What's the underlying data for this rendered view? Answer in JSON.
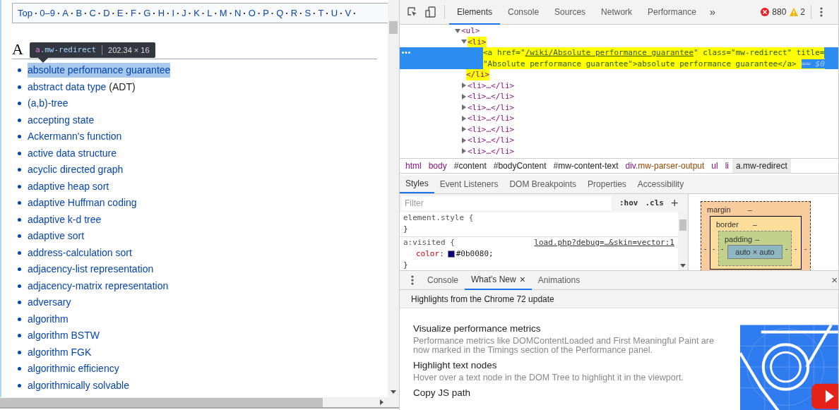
{
  "page": {
    "index_nav": [
      {
        "label": "Top",
        "separator": "·"
      },
      {
        "label": "0–9",
        "separator": "·"
      },
      {
        "label": "A",
        "separator": "·"
      },
      {
        "label": "B",
        "separator": "·"
      },
      {
        "label": "C",
        "separator": "·"
      },
      {
        "label": "D",
        "separator": "·"
      },
      {
        "label": "E",
        "separator": "·"
      },
      {
        "label": "F",
        "separator": "·"
      },
      {
        "label": "G",
        "separator": "·"
      },
      {
        "label": "H",
        "separator": "·"
      },
      {
        "label": "I",
        "separator": "·"
      },
      {
        "label": "J",
        "separator": "·"
      },
      {
        "label": "K",
        "separator": "·"
      },
      {
        "label": "L",
        "separator": "·"
      },
      {
        "label": "M",
        "separator": "·"
      },
      {
        "label": "N",
        "separator": "·"
      },
      {
        "label": "O",
        "separator": "·"
      },
      {
        "label": "P",
        "separator": "·"
      },
      {
        "label": "Q",
        "separator": "·"
      },
      {
        "label": "R",
        "separator": "·"
      },
      {
        "label": "S",
        "separator": "·"
      },
      {
        "label": "T",
        "separator": "·"
      },
      {
        "label": "U",
        "separator": "·"
      },
      {
        "label": "V",
        "separator": "·"
      }
    ],
    "heading": "A",
    "tooltip": {
      "tag": "a",
      "class_name": ".mw-redirect",
      "size": "202.34 × 16"
    },
    "entries": [
      {
        "label": "absolute performance guarantee",
        "selected": true
      },
      {
        "label": "abstract data type",
        "note": "(ADT)",
        "selected": false
      },
      {
        "label": "(a,b)-tree",
        "selected": false
      },
      {
        "label": "accepting state",
        "selected": false
      },
      {
        "label": "Ackermann's function",
        "selected": false
      },
      {
        "label": "active data structure",
        "selected": false
      },
      {
        "label": "acyclic directed graph",
        "selected": false
      },
      {
        "label": "adaptive heap sort",
        "selected": false
      },
      {
        "label": "adaptive Huffman coding",
        "selected": false
      },
      {
        "label": "adaptive k-d tree",
        "selected": false
      },
      {
        "label": "adaptive sort",
        "selected": false
      },
      {
        "label": "address-calculation sort",
        "selected": false
      },
      {
        "label": "adjacency-list representation",
        "selected": false
      },
      {
        "label": "adjacency-matrix representation",
        "selected": false
      },
      {
        "label": "adversary",
        "selected": false
      },
      {
        "label": "algorithm",
        "selected": false
      },
      {
        "label": "algorithm BSTW",
        "selected": false
      },
      {
        "label": "algorithm FGK",
        "selected": false
      },
      {
        "label": "algorithmic efficiency",
        "selected": false
      },
      {
        "label": "algorithmically solvable",
        "selected": false
      }
    ]
  },
  "devtools": {
    "tabs": [
      {
        "label": "Elements",
        "selected": true
      },
      {
        "label": "Console",
        "selected": false
      },
      {
        "label": "Sources",
        "selected": false
      },
      {
        "label": "Network",
        "selected": false
      },
      {
        "label": "Performance",
        "selected": false
      }
    ],
    "overflow": "»",
    "errors": "880",
    "warnings": "2",
    "dom_tree": [
      {
        "open": "<ul>",
        "expanded": true,
        "highlighted": false,
        "children": [
          {
            "open": "<li>",
            "close": "</li>",
            "expanded": true,
            "highlighted": true,
            "children": [
              {
                "kind": "anchor",
                "selected": true,
                "highlighted": true,
                "lines": [
                  [
                    {
                      "kind": "tag",
                      "text": "<a "
                    },
                    {
                      "kind": "attr",
                      "text": "href="
                    },
                    {
                      "kind": "value",
                      "text": "\""
                    },
                    {
                      "kind": "link",
                      "text": "/wiki/Absolute performance guarantee"
                    },
                    {
                      "kind": "value",
                      "text": "\""
                    },
                    {
                      "kind": "attr",
                      "text": " class="
                    },
                    {
                      "kind": "value",
                      "text": "\"mw-redirect\""
                    },
                    {
                      "kind": "attr",
                      "text": " title="
                    }
                  ],
                  [
                    {
                      "kind": "value",
                      "text": "\"Absolute performance guarantee\""
                    },
                    {
                      "kind": "tag",
                      "text": ">"
                    },
                    {
                      "kind": "text",
                      "text": "absolute performance guarantee"
                    },
                    {
                      "kind": "tag",
                      "text": "</a>"
                    }
                  ]
                ],
                "marker": "== $0"
              }
            ]
          },
          {
            "open": "<li>…</li>",
            "expanded": false,
            "highlighted": false
          },
          {
            "open": "<li>…</li>",
            "expanded": false,
            "highlighted": false
          },
          {
            "open": "<li>…</li>",
            "expanded": false,
            "highlighted": false
          },
          {
            "open": "<li>…</li>",
            "expanded": false,
            "highlighted": false
          },
          {
            "open": "<li>…</li>",
            "expanded": false,
            "highlighted": false
          },
          {
            "open": "<li>…</li>",
            "expanded": false,
            "highlighted": false
          },
          {
            "open": "<li>…</li>",
            "expanded": false,
            "highlighted": false
          }
        ]
      }
    ],
    "breadcrumbs": [
      {
        "label": "html",
        "kind": "tag",
        "selected": false
      },
      {
        "label": "body",
        "kind": "tag",
        "selected": false
      },
      {
        "label": "#content",
        "kind": "id",
        "selected": false
      },
      {
        "label": "#bodyContent",
        "kind": "id",
        "selected": false
      },
      {
        "label": "#mw-content-text",
        "kind": "id",
        "selected": false
      },
      {
        "label": "div",
        "suffix": ".mw-parser-output",
        "kind": "tag",
        "selected": false
      },
      {
        "label": "ul",
        "kind": "tag",
        "selected": false
      },
      {
        "label": "li",
        "kind": "tag",
        "selected": false
      },
      {
        "label": "a.mw-redirect",
        "kind": "id",
        "selected": true
      }
    ],
    "side_tabs": [
      {
        "label": "Styles",
        "selected": true
      },
      {
        "label": "Event Listeners",
        "selected": false
      },
      {
        "label": "DOM Breakpoints",
        "selected": false
      },
      {
        "label": "Properties",
        "selected": false
      },
      {
        "label": "Accessibility",
        "selected": false
      }
    ],
    "filter": {
      "placeholder": "Filter"
    },
    "hov": ":hov",
    "cls": ".cls",
    "add": "+",
    "rules": [
      {
        "selector": "element.style {",
        "close": "}"
      },
      {
        "selector": "a:visited {",
        "source": "load.php?debug=…&skin=vector:1",
        "property": "color",
        "colon": ":",
        "value": "#0b0080",
        "terminator": ";",
        "close": "}"
      }
    ],
    "box_model": {
      "margin": {
        "label": "margin",
        "value": "–"
      },
      "border": {
        "label": "border",
        "value": "–"
      },
      "padding": {
        "label": "padding",
        "value": "–"
      },
      "content": "auto × auto",
      "left": [
        "-",
        "-",
        "-"
      ],
      "right": [
        "-",
        "-",
        "-"
      ]
    },
    "drawer_tabs": [
      {
        "label": "Console",
        "selected": false
      },
      {
        "label": "What's New",
        "selected": true,
        "closable": "×"
      },
      {
        "label": "Animations",
        "selected": false
      }
    ],
    "drawer_close": "×",
    "whats_new": {
      "title": "Highlights from the Chrome 72 update",
      "features": [
        {
          "title": "Visualize performance metrics",
          "description": "Performance metrics like DOMContentLoaded and First Meaningful Paint are now marked in the Timings section of the Performance panel."
        },
        {
          "title": "Highlight text nodes",
          "description": "Hover over a text node in the DOM Tree to highlight it in the viewport."
        },
        {
          "title": "Copy JS path"
        }
      ]
    }
  }
}
